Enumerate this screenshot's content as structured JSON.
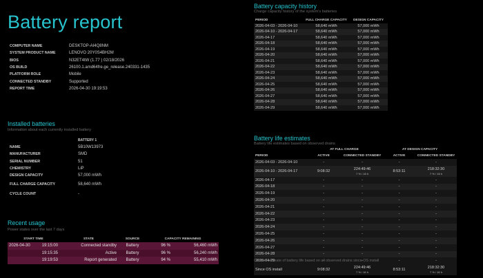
{
  "page": {
    "title": "Battery report"
  },
  "system": {
    "rows": [
      {
        "label": "COMPUTER NAME",
        "value": "DESKTOP-AI4Q8NM"
      },
      {
        "label": "SYSTEM PRODUCT NAME",
        "value": "LENOVO 20Y0S4BH2M"
      },
      {
        "label": "BIOS",
        "value": "N32ET4tW (1.77 ) 02/18/2026"
      },
      {
        "label": "OS BUILD",
        "value": "26100.1.amd64fre.ge_release.240331-1435"
      },
      {
        "label": "PLATFORM ROLE",
        "value": "Mobile"
      },
      {
        "label": "CONNECTED STANDBY",
        "value": "Supported"
      },
      {
        "label": "REPORT TIME",
        "value": "2026-04-30  19:19:53"
      }
    ]
  },
  "installed": {
    "title": "Installed batteries",
    "subtitle": "Information about each currently installed battery",
    "column": "BATTERY 1",
    "rows": [
      {
        "label": "NAME",
        "value": "5B10W13973"
      },
      {
        "label": "MANUFACTURER",
        "value": "SMD"
      },
      {
        "label": "SERIAL NUMBER",
        "value": "51"
      },
      {
        "label": "CHEMISTRY",
        "value": "LiP"
      },
      {
        "label": "DESIGN CAPACITY",
        "value": "57,000 mWh"
      },
      {
        "label": "FULL CHARGE CAPACITY",
        "value": "58,640 mWh"
      },
      {
        "label": "CYCLE COUNT",
        "value": "-"
      }
    ]
  },
  "recent": {
    "title": "Recent usage",
    "subtitle": "Power states over the last 7 days",
    "headers": [
      "START TIME",
      "STATE",
      "SOURCE",
      "CAPACITY REMAINING"
    ],
    "rows": [
      {
        "date": "2026-04-30",
        "time": "19:15:00",
        "state": "Connected standby",
        "source": "Battery",
        "pct": "96 %",
        "mwh": "56,460 mWh"
      },
      {
        "date": "",
        "time": "19:15:35",
        "state": "Active",
        "source": "Battery",
        "pct": "96 %",
        "mwh": "56,240 mWh"
      },
      {
        "date": "",
        "time": "19:19:53",
        "state": "Report generated",
        "source": "Battery",
        "pct": "94 %",
        "mwh": "55,410 mWh"
      }
    ]
  },
  "capacity": {
    "title": "Battery capacity history",
    "subtitle": "Charge capacity history of the system's batteries",
    "headers": [
      "PERIOD",
      "FULL CHARGE CAPACITY",
      "DESIGN CAPACITY"
    ],
    "rows": [
      {
        "period": "2026-04-03 - 2026-04-10",
        "full": "58,640 mWh",
        "design": "57,000 mWh"
      },
      {
        "period": "2026-04-10 - 2026-04-17",
        "full": "58,640 mWh",
        "design": "57,000 mWh"
      },
      {
        "period": "2026-04-17",
        "full": "58,640 mWh",
        "design": "57,000 mWh"
      },
      {
        "period": "2026-04-18",
        "full": "58,640 mWh",
        "design": "57,000 mWh"
      },
      {
        "period": "2026-04-19",
        "full": "58,640 mWh",
        "design": "57,000 mWh"
      },
      {
        "period": "2026-04-20",
        "full": "58,640 mWh",
        "design": "57,000 mWh"
      },
      {
        "period": "2026-04-21",
        "full": "58,640 mWh",
        "design": "57,000 mWh"
      },
      {
        "period": "2026-04-22",
        "full": "58,640 mWh",
        "design": "57,000 mWh"
      },
      {
        "period": "2026-04-23",
        "full": "58,640 mWh",
        "design": "57,000 mWh"
      },
      {
        "period": "2026-04-24",
        "full": "58,640 mWh",
        "design": "57,000 mWh"
      },
      {
        "period": "2026-04-25",
        "full": "58,640 mWh",
        "design": "57,000 mWh"
      },
      {
        "period": "2026-04-26",
        "full": "58,640 mWh",
        "design": "57,000 mWh"
      },
      {
        "period": "2026-04-27",
        "full": "58,640 mWh",
        "design": "57,000 mWh"
      },
      {
        "period": "2026-04-28",
        "full": "58,640 mWh",
        "design": "57,000 mWh"
      },
      {
        "period": "2026-04-29",
        "full": "58,640 mWh",
        "design": "57,000 mWh"
      }
    ]
  },
  "life": {
    "title": "Battery life estimates",
    "subtitle": "Battery life estimates based on observed drains",
    "group_full": "AT FULL CHARGE",
    "group_design": "AT DESIGN CAPACITY",
    "headers": [
      "PERIOD",
      "ACTIVE",
      "CONNECTED STANDBY",
      "ACTIVE",
      "CONNECTED STANDBY"
    ],
    "rows": [
      {
        "period": "2026-04-03 - 2026-04-10",
        "a1": "-",
        "s1": "-",
        "s1sub": "",
        "a2": "-",
        "s2": "-",
        "s2sub": ""
      },
      {
        "period": "2026-04-10 - 2026-04-17",
        "a1": "9:08:32",
        "s1": "224:49:46",
        "s1sub": "7 % / 16 h",
        "a2": "8:53:11",
        "s2": "218:32:30",
        "s2sub": "7 % / 16 h"
      },
      {
        "period": "2026-04-17",
        "a1": "-",
        "s1": "-",
        "s1sub": "",
        "a2": "-",
        "s2": "-",
        "s2sub": ""
      },
      {
        "period": "2026-04-18",
        "a1": "-",
        "s1": "-",
        "s1sub": "",
        "a2": "-",
        "s2": "-",
        "s2sub": ""
      },
      {
        "period": "2026-04-19",
        "a1": "-",
        "s1": "-",
        "s1sub": "",
        "a2": "-",
        "s2": "-",
        "s2sub": ""
      },
      {
        "period": "2026-04-20",
        "a1": "-",
        "s1": "-",
        "s1sub": "",
        "a2": "-",
        "s2": "-",
        "s2sub": ""
      },
      {
        "period": "2026-04-21",
        "a1": "-",
        "s1": "-",
        "s1sub": "",
        "a2": "-",
        "s2": "-",
        "s2sub": ""
      },
      {
        "period": "2026-04-22",
        "a1": "-",
        "s1": "-",
        "s1sub": "",
        "a2": "-",
        "s2": "-",
        "s2sub": ""
      },
      {
        "period": "2026-04-23",
        "a1": "-",
        "s1": "-",
        "s1sub": "",
        "a2": "-",
        "s2": "-",
        "s2sub": ""
      },
      {
        "period": "2026-04-24",
        "a1": "-",
        "s1": "-",
        "s1sub": "",
        "a2": "-",
        "s2": "-",
        "s2sub": ""
      },
      {
        "period": "2026-04-25",
        "a1": "-",
        "s1": "-",
        "s1sub": "",
        "a2": "-",
        "s2": "-",
        "s2sub": ""
      },
      {
        "period": "2026-04-26",
        "a1": "-",
        "s1": "-",
        "s1sub": "",
        "a2": "-",
        "s2": "-",
        "s2sub": ""
      },
      {
        "period": "2026-04-27",
        "a1": "-",
        "s1": "-",
        "s1sub": "",
        "a2": "-",
        "s2": "-",
        "s2sub": ""
      },
      {
        "period": "2026-04-28",
        "a1": "-",
        "s1": "-",
        "s1sub": "",
        "a2": "-",
        "s2": "-",
        "s2sub": ""
      },
      {
        "period": "2026-04-29",
        "a1": "-",
        "s1": "-",
        "s1sub": "",
        "a2": "-",
        "s2": "-",
        "s2sub": ""
      }
    ],
    "note": "Current estimate of battery life based on all observed drains since OS install",
    "since": {
      "period": "Since OS install",
      "a1": "9:08:32",
      "s1": "224:49:46",
      "s1sub": "7 % / 16 h",
      "a2": "8:53:11",
      "s2": "218:32:30",
      "s2sub": "7 % / 16 h"
    }
  },
  "colors": {
    "accent": "#27c4ce",
    "usage_row": "#4a0f2b",
    "background": "#000000"
  }
}
